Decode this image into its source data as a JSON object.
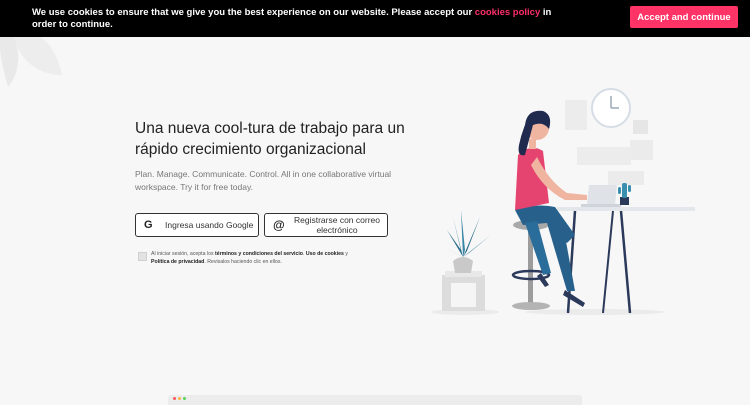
{
  "cookie_banner": {
    "text_before": "We use cookies to ensure that we give you the best experience on our website. Please accept our ",
    "link_text": "cookies policy",
    "text_after": " in order to continue.",
    "accept_label": "Accept and continue",
    "accent_color": "#ff3366"
  },
  "hero": {
    "heading": "Una nueva cool-tura de trabajo para un rápido crecimiento organizacional",
    "subtext": "Plan. Manage. Communicate. Control. All in one collaborative virtual workspace. Try it for free today."
  },
  "buttons": {
    "google_label": "Ingresa usando Google",
    "google_icon": "G",
    "email_label": "Registrarse con correo electrónico",
    "email_icon": "@"
  },
  "terms": {
    "prefix": "Al iniciar sesión, acepta los ",
    "terms_link": "términos y condiciones del servicio",
    "middle": ". ",
    "cookies_link": "Uso de cookies",
    "and": " y ",
    "privacy_link": "Política de privacidad",
    "suffix": ". Revisalos haciendo clic en ellos."
  }
}
